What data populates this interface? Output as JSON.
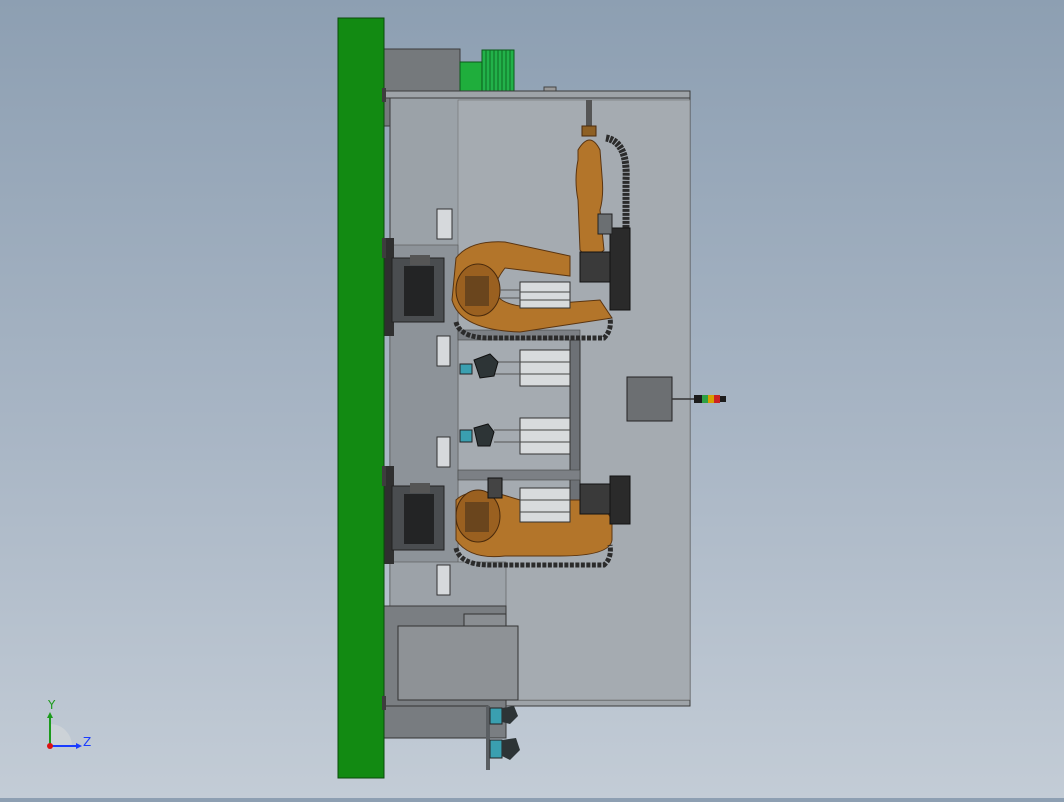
{
  "viewport": {
    "background_top": "#8d9fb2",
    "background_bottom": "#c3ccd6"
  },
  "colors": {
    "wall_green": "#128a12",
    "enclosure_gray": "#9aa1a8",
    "robot_orange": "#b3752a",
    "cable_black": "#2b2b2b",
    "motor_green": "#1fae3c",
    "axis_blue": "#1a3cff",
    "axis_red": "#d11",
    "axis_green": "#1c9a1c"
  },
  "model": {
    "parts": [
      "green-back-wall",
      "cell-enclosure",
      "robot-arm-top",
      "robot-arm-bottom",
      "linear-modules",
      "control-box",
      "signal-tower",
      "drive-motor",
      "fixtures-bottom"
    ]
  },
  "triad": {
    "y_label": "Y",
    "z_label": "Z"
  }
}
